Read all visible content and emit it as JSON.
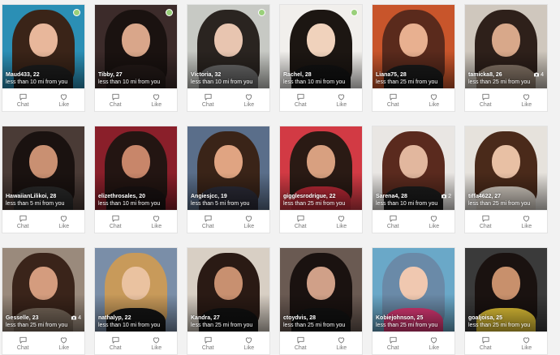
{
  "actions": {
    "chat_label": "Chat",
    "like_label": "Like"
  },
  "icons": {
    "chat": "speech-bubble-icon",
    "like": "heart-outline-icon",
    "photos": "camera-icon",
    "online": "online-status-dot"
  },
  "colors": {
    "online": "#9ad07a",
    "icon_gray": "#777777"
  },
  "profiles": [
    {
      "nameline": "Maud433, 22",
      "distance": "less than 10 mi from you",
      "online": true,
      "photos": "",
      "palette": [
        "#2b8fb5",
        "#3a2418",
        "#e8b79b",
        "#1d1d1d"
      ]
    },
    {
      "nameline": "Tibby, 27",
      "distance": "less than 10 mi from you",
      "online": true,
      "photos": "",
      "palette": [
        "#3c2b2a",
        "#1a1210",
        "#d9a68a",
        "#241a18"
      ]
    },
    {
      "nameline": "Victoria, 32",
      "distance": "less than 10 mi from you",
      "online": true,
      "photos": "",
      "palette": [
        "#c7c9c4",
        "#2a2420",
        "#e8c5b0",
        "#6b6b6b"
      ]
    },
    {
      "nameline": "Rachel, 28",
      "distance": "less than 10 mi from you",
      "online": true,
      "photos": "",
      "palette": [
        "#f1efec",
        "#1c1612",
        "#f0d2bc",
        "#121212"
      ]
    },
    {
      "nameline": "Liana75, 28",
      "distance": "less than 25 mi from you",
      "online": false,
      "photos": "",
      "palette": [
        "#c8552b",
        "#5a2a1c",
        "#e8b090",
        "#1a1a1a"
      ]
    },
    {
      "nameline": "tamicka8, 26",
      "distance": "less than 25 mi from you",
      "online": false,
      "photos": "4",
      "palette": [
        "#cfc7bd",
        "#2e201a",
        "#d8a88a",
        "#8b7a6b"
      ]
    },
    {
      "nameline": "HawaiianLilikoi, 28",
      "distance": "less than 5 mi from you",
      "online": false,
      "photos": "",
      "palette": [
        "#4a3b36",
        "#1a1210",
        "#c99072",
        "#2a2a2a"
      ]
    },
    {
      "nameline": "elizethrosales, 20",
      "distance": "less than 10 mi from you",
      "online": false,
      "photos": "",
      "palette": [
        "#8a1f2a",
        "#231512",
        "#c8866a",
        "#1a1212"
      ]
    },
    {
      "nameline": "Angiesjcc, 19",
      "distance": "less than 5 mi from you",
      "online": false,
      "photos": "",
      "palette": [
        "#5a6e8a",
        "#3a2418",
        "#e0a482",
        "#2c2c38"
      ]
    },
    {
      "nameline": "gigglesrodrigue, 22",
      "distance": "less than 25 mi from you",
      "online": false,
      "photos": "",
      "palette": [
        "#d23a44",
        "#2a1a14",
        "#d8a080",
        "#c02a38"
      ]
    },
    {
      "nameline": "Sarena4, 28",
      "distance": "less than 10 mi from you",
      "online": false,
      "photos": "2",
      "palette": [
        "#e9e6e3",
        "#5a2a1e",
        "#e2b79e",
        "#1c1c1c"
      ]
    },
    {
      "nameline": "tiffa4622, 27",
      "distance": "less than 25 mi from you",
      "online": false,
      "photos": "",
      "palette": [
        "#e6e2dc",
        "#4a2a1a",
        "#e8c0a4",
        "#dad2c8"
      ]
    },
    {
      "nameline": "Gesselle, 23",
      "distance": "less than 25 mi from you",
      "online": false,
      "photos": "4",
      "palette": [
        "#9a8a7c",
        "#3a241a",
        "#d49c7e",
        "#7a6a5c"
      ]
    },
    {
      "nameline": "nathalyp, 22",
      "distance": "less than 10 mi from you",
      "online": false,
      "photos": "",
      "palette": [
        "#7a8ea8",
        "#c89a5a",
        "#eac2a0",
        "#151515"
      ]
    },
    {
      "nameline": "Kandra, 27",
      "distance": "less than 25 mi from you",
      "online": false,
      "photos": "",
      "palette": [
        "#d8cfc4",
        "#2a1a14",
        "#c89070",
        "#111111"
      ]
    },
    {
      "nameline": "ctoydvis, 28",
      "distance": "less than 25 mi from you",
      "online": false,
      "photos": "",
      "palette": [
        "#6a5a52",
        "#1a1210",
        "#d0a088",
        "#121212"
      ]
    },
    {
      "nameline": "Kobiejohnson, 25",
      "distance": "less than 25 mi from you",
      "online": false,
      "photos": "",
      "palette": [
        "#6aa8c8",
        "#6a8aa8",
        "#f0c8b0",
        "#e03a78"
      ]
    },
    {
      "nameline": "goaljoisa, 25",
      "distance": "less than 25 mi from you",
      "online": false,
      "photos": "",
      "palette": [
        "#3a3a3a",
        "#1a1210",
        "#c8906c",
        "#e8c838"
      ]
    }
  ]
}
